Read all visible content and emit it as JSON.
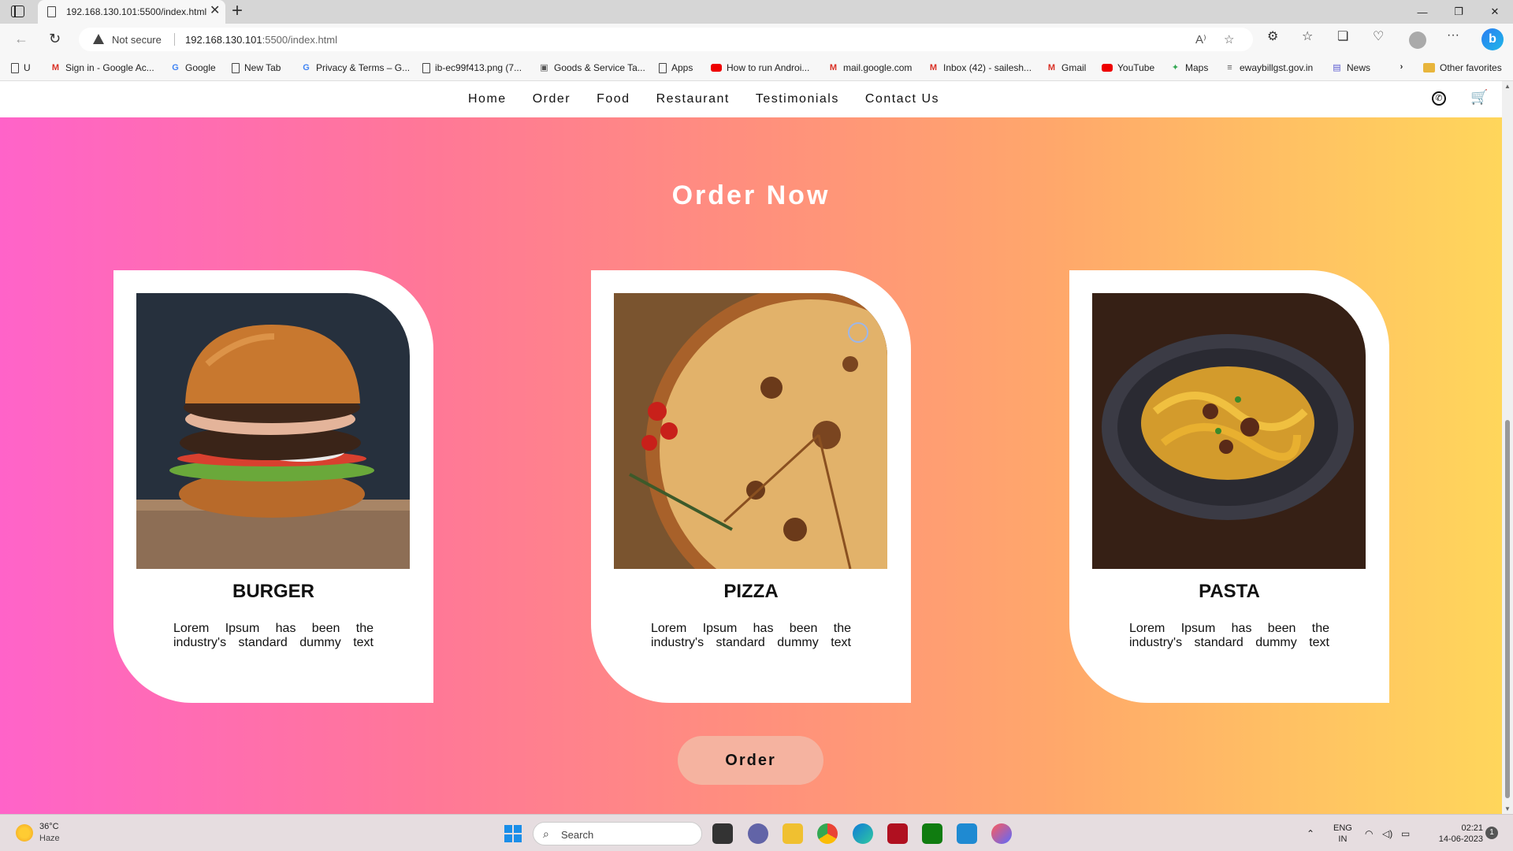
{
  "browser": {
    "tab_title": "192.168.130.101:5500/index.html",
    "security_label": "Not secure",
    "url_host": "192.168.130.101",
    "url_rest": ":5500/index.html",
    "bookmarks": [
      {
        "label": "U",
        "icon": "page-icon"
      },
      {
        "label": "Sign in - Google Ac...",
        "icon": "gmail-icon"
      },
      {
        "label": "Google",
        "icon": "google-icon"
      },
      {
        "label": "New Tab",
        "icon": "page-icon"
      },
      {
        "label": "Privacy & Terms – G...",
        "icon": "google-icon"
      },
      {
        "label": "ib-ec99f413.png (7...",
        "icon": "page-icon"
      },
      {
        "label": "Goods & Service Ta...",
        "icon": "gst-icon"
      },
      {
        "label": "Apps",
        "icon": "page-icon"
      },
      {
        "label": "How to run Androi...",
        "icon": "youtube-icon"
      },
      {
        "label": "mail.google.com",
        "icon": "gmail-icon"
      },
      {
        "label": "Inbox (42) - sailesh...",
        "icon": "gmail-icon"
      },
      {
        "label": "Gmail",
        "icon": "gmail-icon"
      },
      {
        "label": "YouTube",
        "icon": "youtube-icon"
      },
      {
        "label": "Maps",
        "icon": "maps-icon"
      },
      {
        "label": "ewaybillgst.gov.in",
        "icon": "eway-icon"
      },
      {
        "label": "News",
        "icon": "news-icon"
      }
    ],
    "other_favorites": "Other favorites"
  },
  "site": {
    "nav": [
      "Home",
      "Order",
      "Food",
      "Restaurant",
      "Testimonials",
      "Contact Us"
    ],
    "hero_title": "Order Now",
    "cards": [
      {
        "title": "BURGER",
        "text": "Lorem Ipsum has been the industry's standard dummy text"
      },
      {
        "title": "PIZZA",
        "text": "Lorem Ipsum has been the industry's standard dummy text"
      },
      {
        "title": "PASTA",
        "text": "Lorem Ipsum has been the industry's standard dummy text"
      }
    ],
    "order_button": "Order",
    "colors": {
      "gradient_start": "#ff63c9",
      "gradient_end": "#ffd65b",
      "button": "#f5b3a0"
    }
  },
  "taskbar": {
    "weather_temp": "36°C",
    "weather_desc": "Haze",
    "search_placeholder": "Search",
    "lang_top": "ENG",
    "lang_bottom": "IN",
    "time": "02:21",
    "date": "14-06-2023",
    "notifications": "1"
  }
}
